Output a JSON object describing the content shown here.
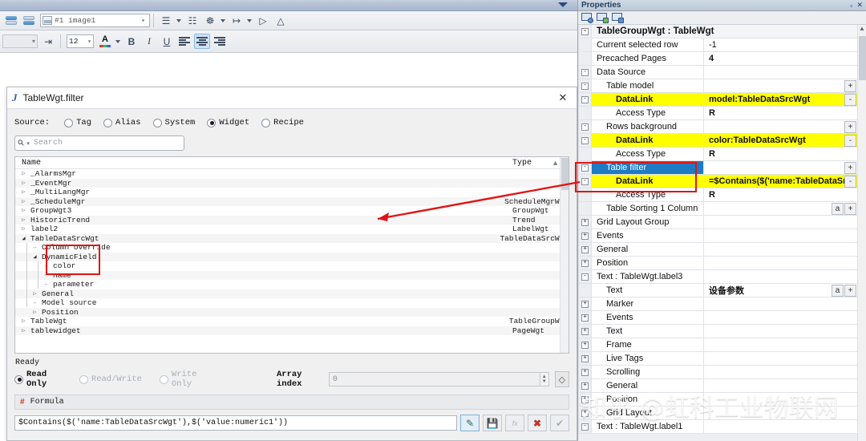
{
  "toolbar": {
    "image_selector": {
      "value": "#1 image1",
      "icon": "image-thumbnail-icon"
    },
    "font_size": "12",
    "buttons": {
      "bring_to_front": "bring-to-front",
      "send_to_back": "send-to-back",
      "align": "align",
      "resize": "resize",
      "distribute": "distribute",
      "same_width": "same-width",
      "flip": "flip",
      "rotate": "rotate",
      "indent": "indent",
      "font_color": "A",
      "bold": "B",
      "italic": "I",
      "underline": "U",
      "align_left": "align-left",
      "align_center": "align-center",
      "align_right": "align-right"
    }
  },
  "dialog": {
    "title": "TableWgt.filter",
    "icon": "J",
    "close": "✕",
    "source_label": "Source:",
    "source_options": [
      {
        "label": "Tag",
        "selected": false
      },
      {
        "label": "Alias",
        "selected": false
      },
      {
        "label": "System",
        "selected": false
      },
      {
        "label": "Widget",
        "selected": true
      },
      {
        "label": "Recipe",
        "selected": false
      }
    ],
    "search_placeholder": "Search",
    "tree_headers": {
      "name": "Name",
      "type": "Type"
    },
    "tree_rows": [
      {
        "name": "_AlarmsMgr",
        "type": "",
        "indent": 0,
        "marker": "collapsed"
      },
      {
        "name": "_EventMgr",
        "type": "",
        "indent": 0,
        "marker": "collapsed"
      },
      {
        "name": "_MultiLangMgr",
        "type": "",
        "indent": 0,
        "marker": "collapsed"
      },
      {
        "name": "_ScheduleMgr",
        "type": "ScheduleMgrWgt",
        "indent": 0,
        "marker": "collapsed"
      },
      {
        "name": "GroupWgt3",
        "type": "GroupWgt",
        "indent": 0,
        "marker": "collapsed"
      },
      {
        "name": "HistoricTrend",
        "type": "Trend",
        "indent": 0,
        "marker": "collapsed"
      },
      {
        "name": "label2",
        "type": "LabelWgt",
        "indent": 0,
        "marker": "collapsed"
      },
      {
        "name": "TableDataSrcWgt",
        "type": "TableDataSrcWgt",
        "indent": 0,
        "marker": "expanded"
      },
      {
        "name": "Column override",
        "type": "",
        "indent": 1,
        "marker": "leaf"
      },
      {
        "name": "DynamicField",
        "type": "",
        "indent": 1,
        "marker": "expanded"
      },
      {
        "name": "color",
        "type": "",
        "indent": 2,
        "marker": "leaf"
      },
      {
        "name": "name",
        "type": "",
        "indent": 2,
        "marker": "leaf"
      },
      {
        "name": "parameter",
        "type": "",
        "indent": 2,
        "marker": "leaf"
      },
      {
        "name": "General",
        "type": "",
        "indent": 1,
        "marker": "collapsed"
      },
      {
        "name": "Model source",
        "type": "",
        "indent": 1,
        "marker": "leaf"
      },
      {
        "name": "Position",
        "type": "",
        "indent": 1,
        "marker": "collapsed"
      },
      {
        "name": "TableWgt",
        "type": "TableGroupWgt",
        "indent": 0,
        "marker": "collapsed"
      },
      {
        "name": "tablewidget",
        "type": "PageWgt",
        "indent": 0,
        "marker": "collapsed"
      }
    ],
    "status": "Ready",
    "access_options": [
      {
        "label": "Read Only",
        "selected": true
      },
      {
        "label": "Read/Write",
        "selected": false
      },
      {
        "label": "Write Only",
        "selected": false
      }
    ],
    "array_index_label": "Array index",
    "array_index_value": "0",
    "formula_title": "Formula",
    "formula_hash": "#",
    "formula_value": "$Contains($('name:TableDataSrcWgt'),$('value:numeric1'))",
    "formula_buttons": [
      {
        "name": "edit-formula-button",
        "glyph": "✎",
        "state": "selected"
      },
      {
        "name": "save-formula-button",
        "glyph": "ὋE",
        "state": "dim"
      },
      {
        "name": "fx-button",
        "glyph": "ƒx",
        "state": "dim"
      },
      {
        "name": "cancel-button",
        "glyph": "✖",
        "state": "red"
      },
      {
        "name": "confirm-button",
        "glyph": "✔",
        "state": "dim"
      }
    ]
  },
  "properties": {
    "panel_title": "Properties",
    "pin_icon": "▫",
    "close_icon": "✕",
    "rows": [
      {
        "name": "TableGroupWgt : TableWgt",
        "value": "",
        "indent": 0,
        "type": "header",
        "expander": "-"
      },
      {
        "name": "Current selected row",
        "value": "-1",
        "indent": 0,
        "type": "normal",
        "expander": ""
      },
      {
        "name": "Precached Pages",
        "value": "4",
        "indent": 0,
        "type": "bold-val",
        "expander": ""
      },
      {
        "name": "Data Source",
        "value": "",
        "indent": 0,
        "type": "normal",
        "expander": "-"
      },
      {
        "name": "Table model",
        "value": "",
        "indent": 1,
        "type": "normal",
        "expander": "-",
        "btn": "+"
      },
      {
        "name": "DataLink",
        "value": "model:TableDataSrcWgt",
        "indent": 2,
        "type": "yellow",
        "expander": "-",
        "btn": "-"
      },
      {
        "name": "Access Type",
        "value": "R",
        "indent": 2,
        "type": "bold-val",
        "expander": ""
      },
      {
        "name": "Rows background",
        "value": "",
        "indent": 1,
        "type": "normal",
        "expander": "-",
        "btn": "+"
      },
      {
        "name": "DataLink",
        "value": "color:TableDataSrcWgt",
        "indent": 2,
        "type": "yellow",
        "expander": "-",
        "btn": "-"
      },
      {
        "name": "Access Type",
        "value": "R",
        "indent": 2,
        "type": "bold-val",
        "expander": ""
      },
      {
        "name": "Table filter",
        "value": "",
        "indent": 1,
        "type": "blue-sel",
        "expander": "-",
        "btn": "+"
      },
      {
        "name": "DataLink",
        "value": "=$Contains($('name:TableDataSrcW",
        "indent": 2,
        "type": "yellow",
        "expander": "-",
        "btn": "-"
      },
      {
        "name": "Access Type",
        "value": "R",
        "indent": 2,
        "type": "bold-val",
        "expander": ""
      },
      {
        "name": "Table Sorting 1 Column",
        "value": "",
        "indent": 1,
        "type": "normal",
        "expander": "",
        "btn": "a+"
      },
      {
        "name": "Grid Layout Group",
        "value": "",
        "indent": 0,
        "type": "normal",
        "expander": "+"
      },
      {
        "name": "Events",
        "value": "",
        "indent": 0,
        "type": "normal",
        "expander": "+"
      },
      {
        "name": "General",
        "value": "",
        "indent": 0,
        "type": "normal",
        "expander": "+"
      },
      {
        "name": "Position",
        "value": "",
        "indent": 0,
        "type": "normal",
        "expander": "+"
      },
      {
        "name": "Text : TableWgt.label3",
        "value": "",
        "indent": 0,
        "type": "normal",
        "expander": "-"
      },
      {
        "name": "Text",
        "value": "设备参数",
        "indent": 1,
        "type": "bold-val",
        "expander": "",
        "btn": "a+"
      },
      {
        "name": "Marker",
        "value": "",
        "indent": 1,
        "type": "normal",
        "expander": "+"
      },
      {
        "name": "Events",
        "value": "",
        "indent": 1,
        "type": "normal",
        "expander": "+"
      },
      {
        "name": "Text",
        "value": "",
        "indent": 1,
        "type": "normal",
        "expander": "+"
      },
      {
        "name": "Frame",
        "value": "",
        "indent": 1,
        "type": "normal",
        "expander": "+"
      },
      {
        "name": "Live Tags",
        "value": "",
        "indent": 1,
        "type": "normal",
        "expander": "+"
      },
      {
        "name": "Scrolling",
        "value": "",
        "indent": 1,
        "type": "normal",
        "expander": "+"
      },
      {
        "name": "General",
        "value": "",
        "indent": 1,
        "type": "normal",
        "expander": "+"
      },
      {
        "name": "Position",
        "value": "",
        "indent": 1,
        "type": "normal",
        "expander": "+"
      },
      {
        "name": "Grid Layout",
        "value": "",
        "indent": 1,
        "type": "normal",
        "expander": "+"
      },
      {
        "name": "Text : TableWgt.label1",
        "value": "",
        "indent": 0,
        "type": "normal",
        "expander": "-"
      }
    ]
  },
  "watermark": {
    "text": "知乎 @虹科工业物联网"
  },
  "colors": {
    "highlight_yellow": "#ffff00",
    "selection_blue": "#1f7ac4",
    "annotation_red": "#e11414"
  }
}
